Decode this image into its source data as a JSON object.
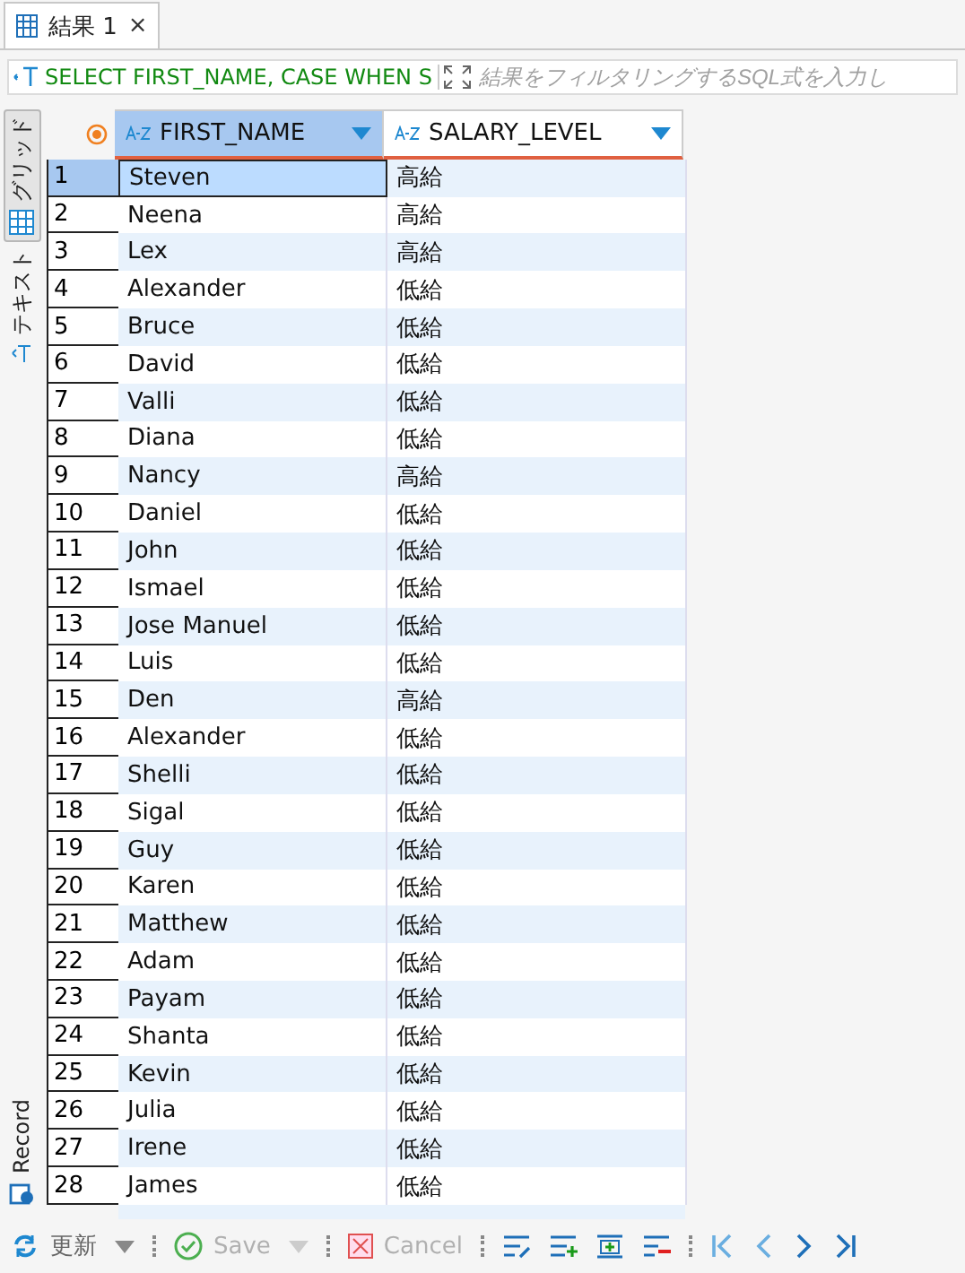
{
  "tab": {
    "title": "結果 1",
    "close": "×"
  },
  "filter": {
    "query": "SELECT FIRST_NAME, CASE WHEN S",
    "placeholder": "結果をフィルタリングするSQL式を入力し"
  },
  "side_tabs": [
    {
      "label": "グリッド",
      "selected": true
    },
    {
      "label": "テキスト",
      "selected": false
    }
  ],
  "record_label": "Record",
  "columns": [
    {
      "name": "FIRST_NAME",
      "selected": true
    },
    {
      "name": "SALARY_LEVEL",
      "selected": false
    }
  ],
  "rows": [
    {
      "n": "1",
      "first_name": "Steven",
      "level": "高給",
      "selected": true
    },
    {
      "n": "2",
      "first_name": "Neena",
      "level": "高給",
      "selected": false
    },
    {
      "n": "3",
      "first_name": "Lex",
      "level": "高給",
      "selected": false
    },
    {
      "n": "4",
      "first_name": "Alexander",
      "level": "低給",
      "selected": false
    },
    {
      "n": "5",
      "first_name": "Bruce",
      "level": "低給",
      "selected": false
    },
    {
      "n": "6",
      "first_name": "David",
      "level": "低給",
      "selected": false
    },
    {
      "n": "7",
      "first_name": "Valli",
      "level": "低給",
      "selected": false
    },
    {
      "n": "8",
      "first_name": "Diana",
      "level": "低給",
      "selected": false
    },
    {
      "n": "9",
      "first_name": "Nancy",
      "level": "高給",
      "selected": false
    },
    {
      "n": "10",
      "first_name": "Daniel",
      "level": "低給",
      "selected": false
    },
    {
      "n": "11",
      "first_name": "John",
      "level": "低給",
      "selected": false
    },
    {
      "n": "12",
      "first_name": "Ismael",
      "level": "低給",
      "selected": false
    },
    {
      "n": "13",
      "first_name": "Jose Manuel",
      "level": "低給",
      "selected": false
    },
    {
      "n": "14",
      "first_name": "Luis",
      "level": "低給",
      "selected": false
    },
    {
      "n": "15",
      "first_name": "Den",
      "level": "高給",
      "selected": false
    },
    {
      "n": "16",
      "first_name": "Alexander",
      "level": "低給",
      "selected": false
    },
    {
      "n": "17",
      "first_name": "Shelli",
      "level": "低給",
      "selected": false
    },
    {
      "n": "18",
      "first_name": "Sigal",
      "level": "低給",
      "selected": false
    },
    {
      "n": "19",
      "first_name": "Guy",
      "level": "低給",
      "selected": false
    },
    {
      "n": "20",
      "first_name": "Karen",
      "level": "低給",
      "selected": false
    },
    {
      "n": "21",
      "first_name": "Matthew",
      "level": "低給",
      "selected": false
    },
    {
      "n": "22",
      "first_name": "Adam",
      "level": "低給",
      "selected": false
    },
    {
      "n": "23",
      "first_name": "Payam",
      "level": "低給",
      "selected": false
    },
    {
      "n": "24",
      "first_name": "Shanta",
      "level": "低給",
      "selected": false
    },
    {
      "n": "25",
      "first_name": "Kevin",
      "level": "低給",
      "selected": false
    },
    {
      "n": "26",
      "first_name": "Julia",
      "level": "低給",
      "selected": false
    },
    {
      "n": "27",
      "first_name": "Irene",
      "level": "低給",
      "selected": false
    },
    {
      "n": "28",
      "first_name": "James",
      "level": "低給",
      "selected": false
    }
  ],
  "toolbar": [
    {
      "kind": "refresh",
      "label": "更新",
      "disabled": false
    },
    {
      "kind": "save",
      "label": "Save",
      "disabled": true
    },
    {
      "kind": "cancel",
      "label": "Cancel",
      "disabled": true
    }
  ]
}
